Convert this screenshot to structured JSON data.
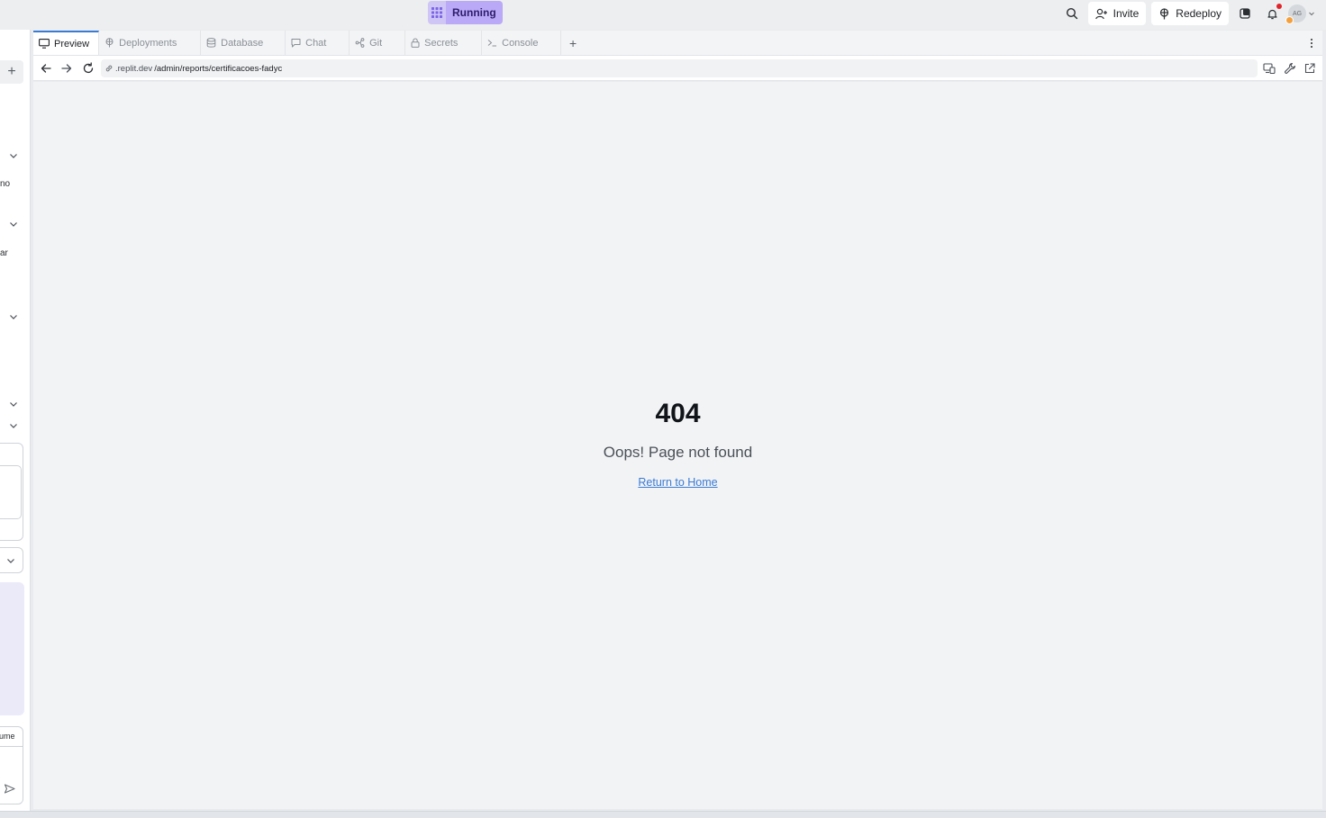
{
  "topbar": {
    "run_label": "Running",
    "invite_label": "Invite",
    "redeploy_label": "Redeploy",
    "avatar_initials": "AG"
  },
  "left_panel": {
    "snippet_1": "no",
    "snippet_2": "ar",
    "snippet_3": "ume"
  },
  "tabs": [
    {
      "label": "Preview",
      "icon": "monitor-icon",
      "active": true
    },
    {
      "label": "Deployments",
      "icon": "deployments-icon",
      "active": false
    },
    {
      "label": "Database",
      "icon": "database-icon",
      "active": false
    },
    {
      "label": "Chat",
      "icon": "chat-icon",
      "active": false
    },
    {
      "label": "Git",
      "icon": "git-icon",
      "active": false
    },
    {
      "label": "Secrets",
      "icon": "lock-icon",
      "active": false
    },
    {
      "label": "Console",
      "icon": "terminal-icon",
      "active": false
    }
  ],
  "address": {
    "host": ".replit.dev",
    "path": "/admin/reports/certificacoes-fadyc"
  },
  "page": {
    "code": "404",
    "message": "Oops! Page not found",
    "link": "Return to Home"
  },
  "colors": {
    "accent": "#3a7bd5",
    "running": "#b9a9f7",
    "notification": "#e0242a"
  }
}
